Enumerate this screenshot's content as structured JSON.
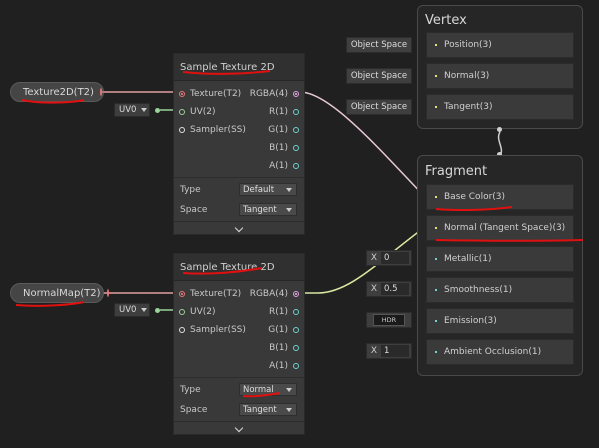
{
  "properties": {
    "texture2d": "Texture2D(T2)",
    "normalmap": "NormalMap(T2)"
  },
  "node1": {
    "title": "Sample Texture 2D",
    "inputs": [
      "Texture(T2)",
      "UV(2)",
      "Sampler(SS)"
    ],
    "outputs": [
      "RGBA(4)",
      "R(1)",
      "G(1)",
      "B(1)",
      "A(1)"
    ],
    "type_label": "Type",
    "type_value": "Default",
    "space_label": "Space",
    "space_value": "Tangent"
  },
  "node2": {
    "title": "Sample Texture 2D",
    "inputs": [
      "Texture(T2)",
      "UV(2)",
      "Sampler(SS)"
    ],
    "outputs": [
      "RGBA(4)",
      "R(1)",
      "G(1)",
      "B(1)",
      "A(1)"
    ],
    "type_label": "Type",
    "type_value": "Normal",
    "space_label": "Space",
    "space_value": "Tangent"
  },
  "uv": {
    "label": "UV0"
  },
  "vertex": {
    "title": "Vertex",
    "space_label": "Object Space",
    "blocks": [
      "Position(3)",
      "Normal(3)",
      "Tangent(3)"
    ]
  },
  "fragment": {
    "title": "Fragment",
    "blocks": [
      "Base Color(3)",
      "Normal (Tangent Space)(3)",
      "Metallic(1)",
      "Smoothness(1)",
      "Emission(3)",
      "Ambient Occlusion(1)"
    ],
    "metallic_value": "0",
    "smoothness_value": "0.5",
    "ao_value": "1",
    "x_label": "X",
    "hdr_label": "HDR"
  },
  "colors": {
    "background": "#202020",
    "node_body": "#393939",
    "wire_texture": "#e0a0a0",
    "wire_rgba": "#e8c8d8",
    "wire_vector": "#d8e8a0",
    "annotation": "#e01010"
  }
}
